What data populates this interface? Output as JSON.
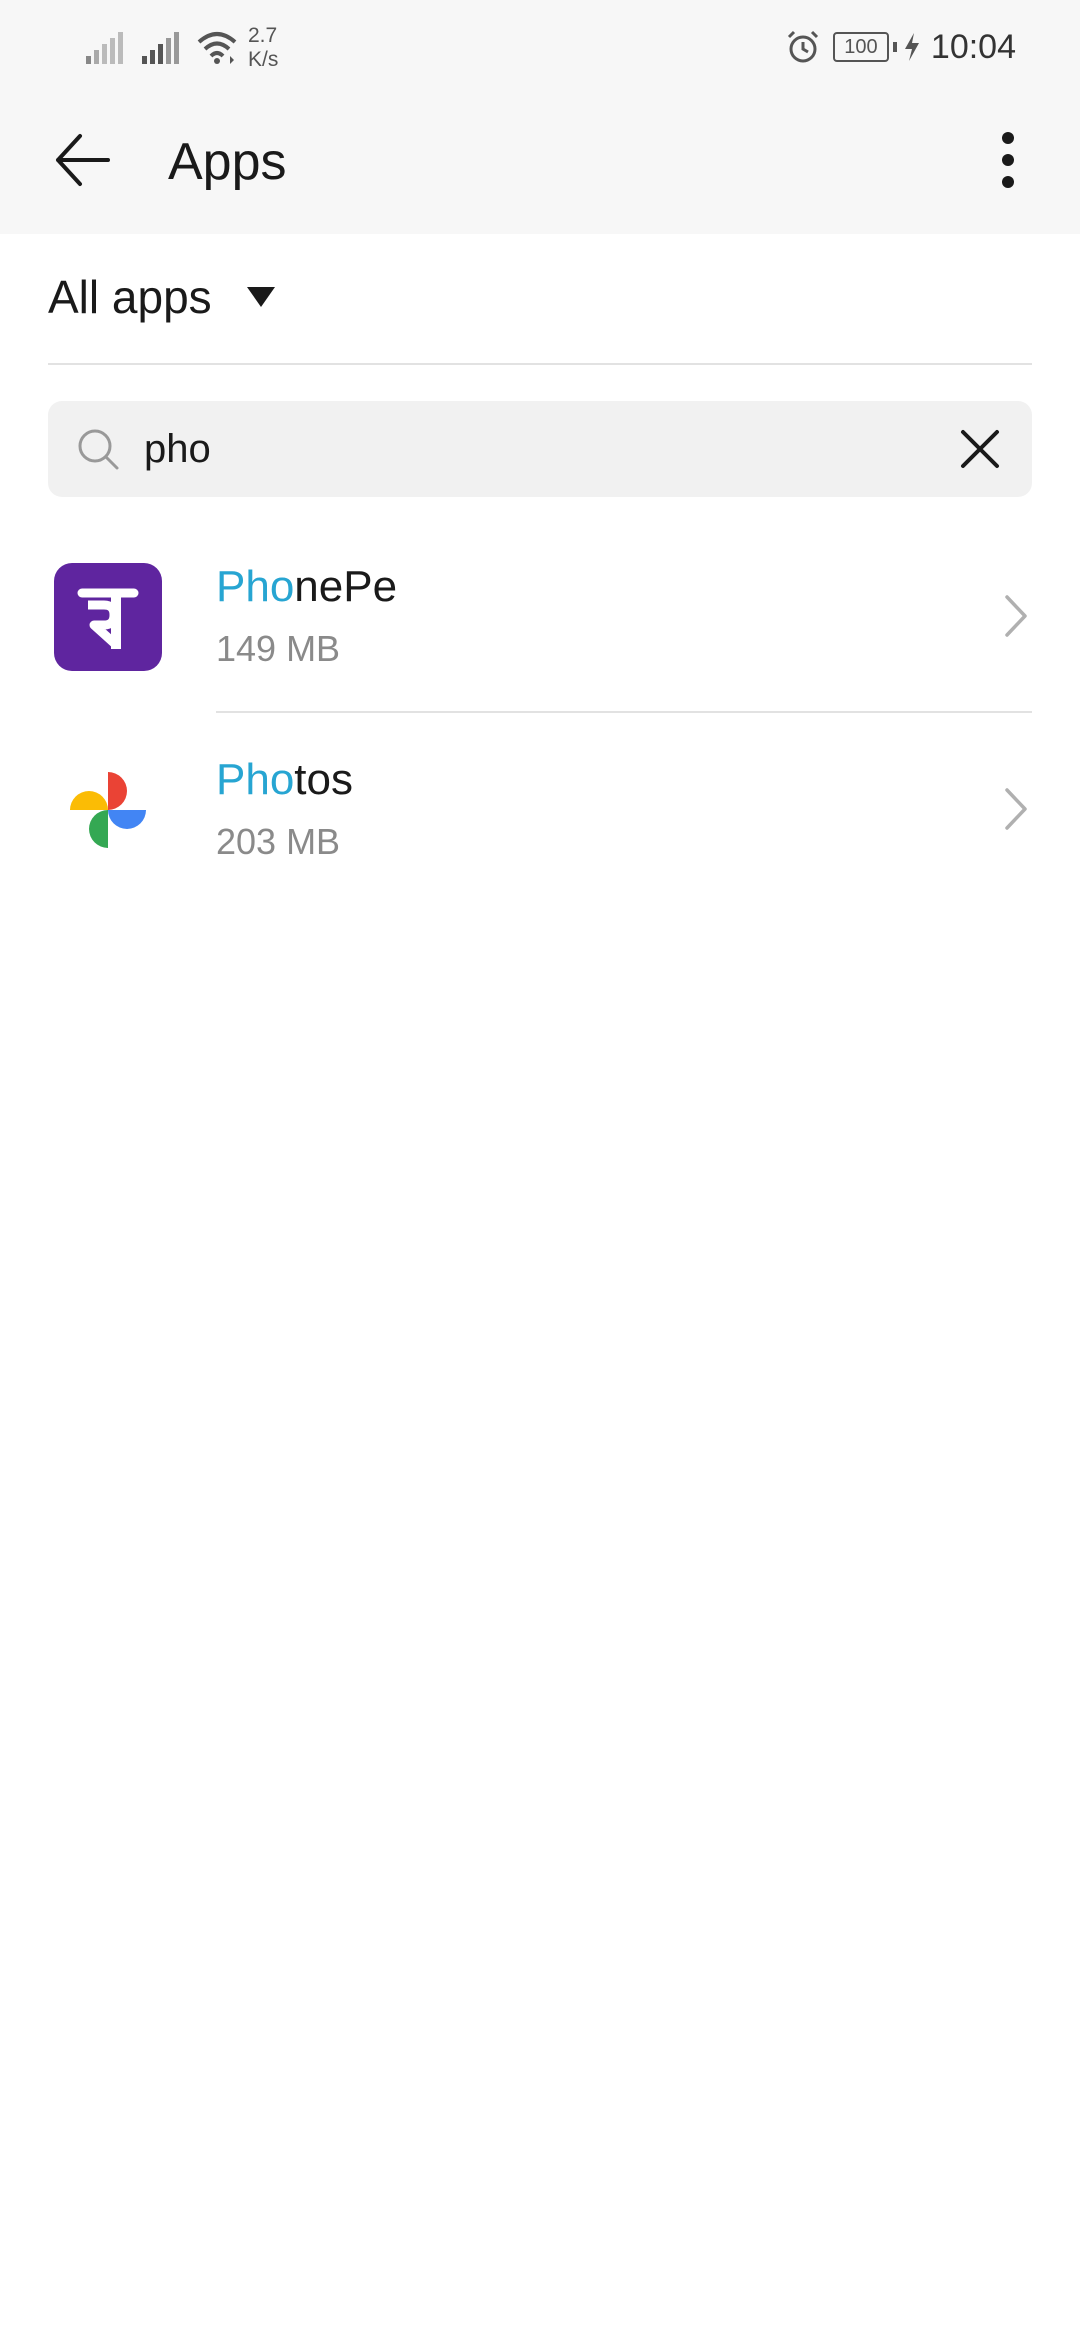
{
  "status_bar": {
    "net_speed_value": "2.7",
    "net_speed_unit": "K/s",
    "battery_level": "100",
    "time": "10:04",
    "icons": [
      "signal-icon",
      "signal-icon",
      "wifi-icon",
      "alarm-icon",
      "battery-icon",
      "charging-icon"
    ]
  },
  "app_bar": {
    "title": "Apps",
    "back_icon": "arrow-left-icon",
    "more_icon": "more-vertical-icon"
  },
  "filter": {
    "selected": "All apps",
    "icon": "caret-down-icon"
  },
  "search": {
    "value": "pho",
    "placeholder": "",
    "icon": "search-icon",
    "clear_icon": "close-icon"
  },
  "apps": [
    {
      "name_match": "Pho",
      "name_rest": "nePe",
      "size": "149 MB",
      "icon": "phonepe-icon",
      "brand_color": "#5f259f"
    },
    {
      "name_match": "Pho",
      "name_rest": "tos",
      "size": "203 MB",
      "icon": "google-photos-icon",
      "brand_color": "#4285f4"
    }
  ],
  "colors": {
    "match_highlight": "#27a5d2",
    "app_bar_bg": "#f7f7f7",
    "search_bg": "#f1f1f1"
  }
}
